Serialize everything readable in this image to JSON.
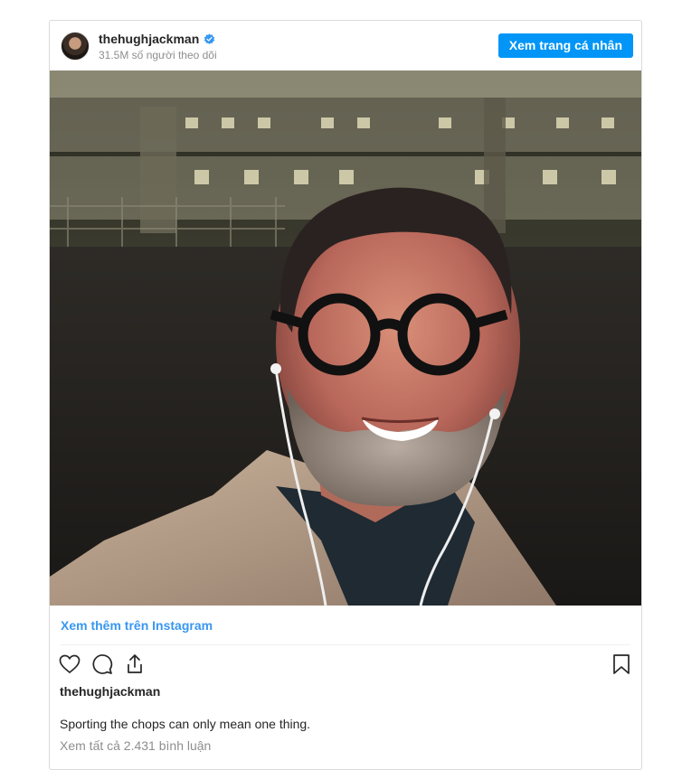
{
  "header": {
    "username": "thehughjackman",
    "followers": "31.5M số người theo dõi",
    "view_profile_label": "Xem trang cá nhân"
  },
  "links": {
    "view_more": "Xem thêm trên Instagram",
    "view_comments": "Xem tất cả 2.431 bình luận"
  },
  "post": {
    "poster_username": "thehughjackman",
    "caption": "Sporting the chops can only mean one thing."
  },
  "icons": [
    "verified-icon",
    "heart-icon",
    "comment-icon",
    "share-icon",
    "bookmark-icon"
  ],
  "colors": {
    "accent": "#0095f6",
    "link": "#3897f0",
    "muted": "#8e8e8e",
    "text": "#262626"
  }
}
